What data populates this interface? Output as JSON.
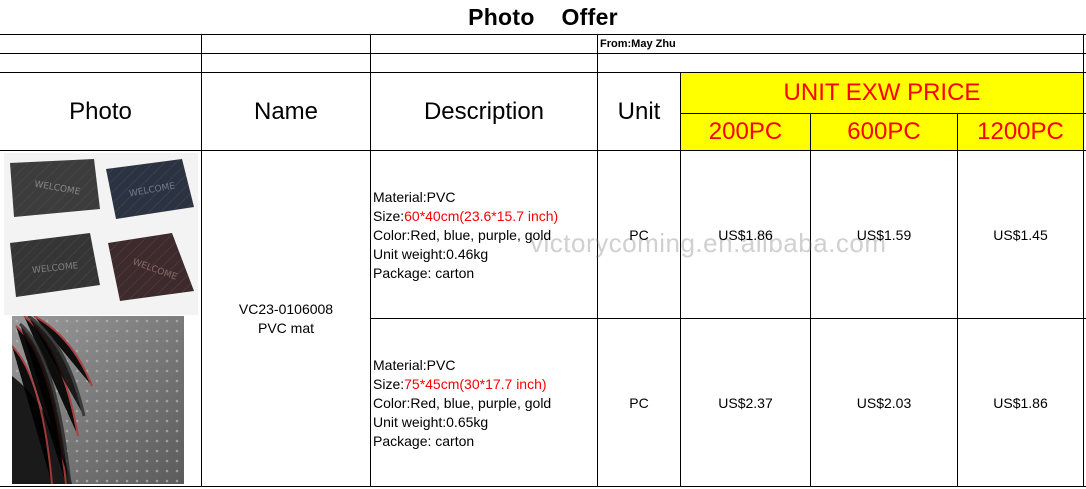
{
  "title": "Photo    Offer",
  "from": "From:May Zhu",
  "headers": {
    "photo": "Photo",
    "name": "Name",
    "description": "Description",
    "unit": "Unit",
    "price_group": "UNIT EXW PRICE",
    "quantities": [
      "200PC",
      "600PC",
      "1200PC"
    ]
  },
  "product": {
    "name_line1": "VC23-0106008",
    "name_line2": "PVC mat"
  },
  "rows": [
    {
      "material": "Material:PVC",
      "size_label": "Size:",
      "size_value": "60*40cm(23.6*15.7 inch)",
      "color": "Color:Red, blue, purple, gold",
      "weight": "Unit weight:0.46kg",
      "package": "Package: carton",
      "unit": "PC",
      "prices": [
        "US$1.86",
        "US$1.59",
        "US$1.45"
      ]
    },
    {
      "material": "Material:PVC",
      "size_label": "Size:",
      "size_value": "75*45cm(30*17.7 inch)",
      "color": "Color:Red, blue, purple, gold",
      "weight": "Unit weight:0.65kg",
      "package": "Package: carton",
      "unit": "PC",
      "prices": [
        "US$2.37",
        "US$2.03",
        "US$1.86"
      ]
    }
  ],
  "watermark": "victorycoming.en.alibaba.com",
  "mat_labels": [
    "WELCOME",
    "WELCOME",
    "WELCOME",
    "WELCOME"
  ],
  "colors": {
    "highlight": "#ffff00",
    "accent_red": "#ff0000",
    "rule": "#000000"
  }
}
